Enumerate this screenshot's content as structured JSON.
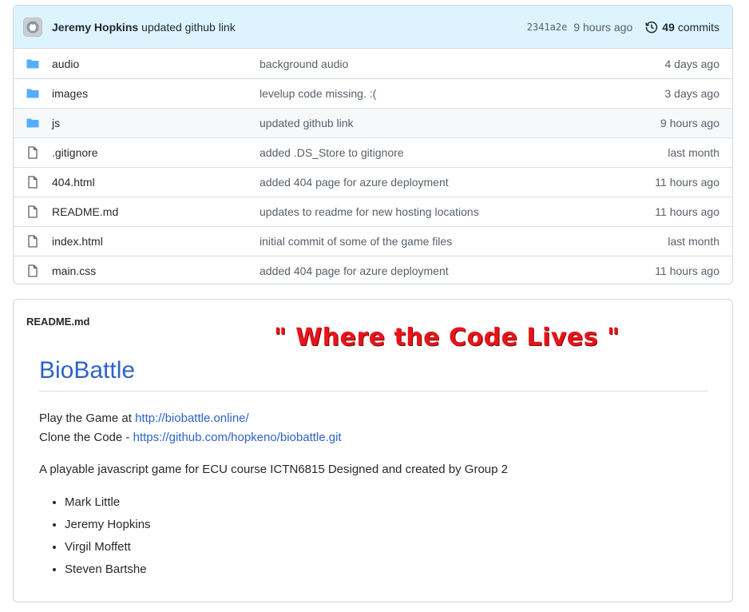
{
  "commit": {
    "author": "Jeremy Hopkins",
    "message": "updated github link",
    "sha": "2341a2e",
    "time": "9 hours ago",
    "count": "49",
    "count_label": "commits"
  },
  "files": [
    {
      "name": "audio",
      "type": "folder",
      "message": "background audio",
      "age": "4 days ago"
    },
    {
      "name": "images",
      "type": "folder",
      "message": "levelup code missing. :(",
      "age": "3 days ago"
    },
    {
      "name": "js",
      "type": "folder",
      "message": "updated github link",
      "age": "9 hours ago"
    },
    {
      "name": ".gitignore",
      "type": "file",
      "message": "added .DS_Store to gitignore",
      "age": "last month"
    },
    {
      "name": "404.html",
      "type": "file",
      "message": "added 404 page for azure deployment",
      "age": "11 hours ago"
    },
    {
      "name": "README.md",
      "type": "file",
      "message": "updates to readme for new hosting locations",
      "age": "11 hours ago"
    },
    {
      "name": "index.html",
      "type": "file",
      "message": "initial commit of some of the game files",
      "age": "last month"
    },
    {
      "name": "main.css",
      "type": "file",
      "message": "added 404 page for azure deployment",
      "age": "11 hours ago"
    }
  ],
  "readme": {
    "filename": "README.md",
    "overlay_caption": "\" Where the Code Lives \"",
    "title": "BioBattle",
    "play_prefix": "Play the Game at ",
    "play_url": "http://biobattle.online/",
    "clone_prefix": "Clone the Code - ",
    "clone_url": "https://github.com/hopkeno/biobattle.git",
    "description": "A playable javascript game for ECU course ICTN6815 Designed and created by Group 2",
    "team": [
      "Mark Little",
      "Jeremy Hopkins",
      "Virgil Moffett",
      "Steven Bartshe"
    ]
  },
  "colors": {
    "folder_icon": "#54aeff",
    "link": "#2e63c5",
    "overlay": "#e8141a"
  }
}
